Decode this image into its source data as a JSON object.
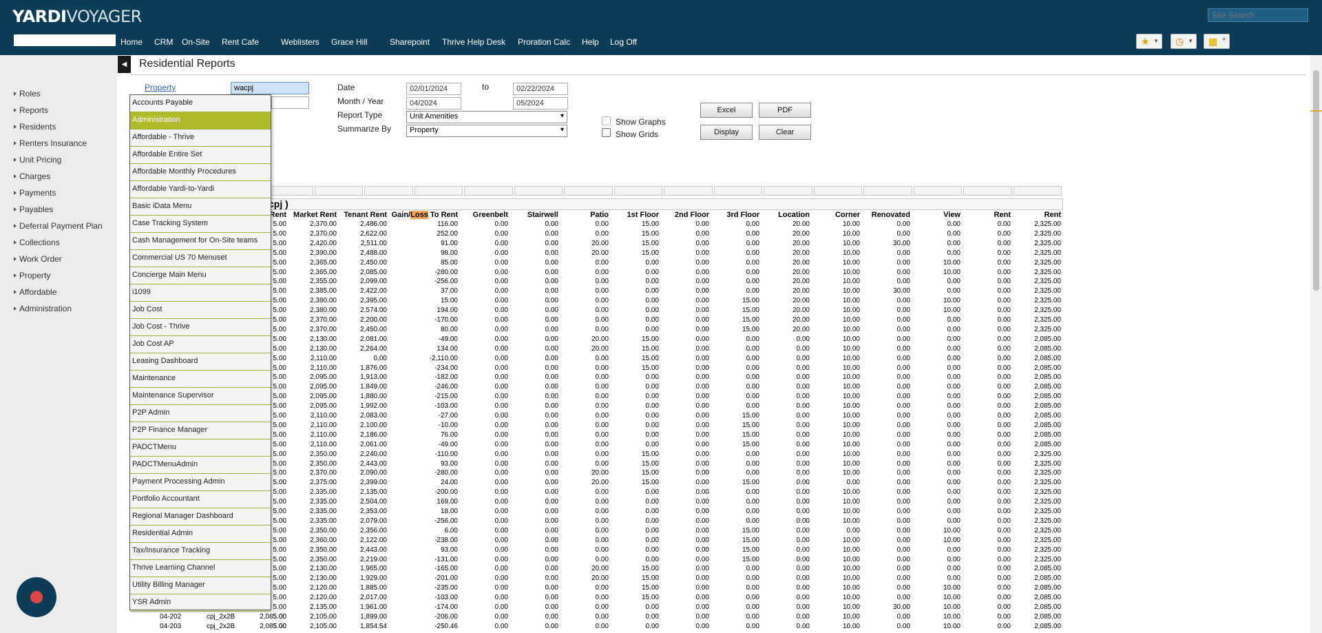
{
  "header": {
    "logo_bold": "YARDI",
    "logo_light": "VOYAGER",
    "site_search_placeholder": "Site Search",
    "search_value": "",
    "nav": [
      "Home",
      "CRM",
      "On-Site",
      "Rent Cafe",
      "Weblisters",
      "Grace Hill",
      "Sharepoint",
      "Thrive Help Desk",
      "Proration Calc",
      "Help",
      "Log Off"
    ]
  },
  "sidebar": {
    "items": [
      "Roles",
      "Reports",
      "Residents",
      "Renters Insurance",
      "Unit Pricing",
      "Charges",
      "Payments",
      "Payables",
      "Deferral Payment Plan",
      "Collections",
      "Work Order",
      "Property",
      "Affordable",
      "Administration"
    ]
  },
  "page": {
    "title": "Residential Reports"
  },
  "form": {
    "property_label": "Property",
    "property_value": "wacpj",
    "date_label": "Date",
    "date_from": "02/01/2024",
    "to_label": "to",
    "date_to": "02/22/2024",
    "month_year_label": "Month / Year",
    "month_from": "04/2024",
    "month_to": "05/2024",
    "report_type_label": "Report Type",
    "report_type_value": "Unit Amenities",
    "summarize_label": "Summarize By",
    "summarize_value": "Property",
    "show_graphs_label": "Show Graphs",
    "show_grids_label": "Show Grids",
    "buttons": {
      "excel": "Excel",
      "pdf": "PDF",
      "display": "Display",
      "clear": "Clear"
    }
  },
  "dropdown": {
    "items": [
      "Accounts Payable",
      "Administration",
      "Affordable - Thrive",
      "Affordable Entire Set",
      "Affordable Monthly Procedures",
      "Affordable Yardi-to-Yardi",
      "Basic iData Menu",
      "Case Tracking System",
      "Cash Management for On-Site teams",
      "Commercial US 70 Menuset",
      "Concierge Main Menu",
      "i1099",
      "Job Cost",
      "Job Cost - Thrive",
      "Job Cost AP",
      "Leasing Dashboard",
      "Maintenance",
      "Maintenance Supervisor",
      "P2P Admin",
      "P2P Finance Manager",
      "PADCTMenu",
      "PADCTMenuAdmin",
      "Payment Processing Admin",
      "Portfolio Accountant",
      "Regional Manager Dashboard",
      "Residential Admin",
      "Tax/Insurance Tracking",
      "Thrive Learning Channel",
      "Utility Billing Manager",
      "YSR Admin"
    ],
    "active_index": 1
  },
  "report": {
    "group_title": "cpj )",
    "columns": [
      "Rent",
      "Market Rent",
      "Tenant Rent",
      "Gain/Loss To Rent",
      "Greenbelt",
      "Stairwell",
      "Patio",
      "1st Floor",
      "2nd Floor",
      "3rd Floor",
      "Location",
      "Corner",
      "Renovated",
      "View",
      "Rent",
      "Rent"
    ],
    "highlight_col": 3,
    "highlight_part": "Loss",
    "rows": [
      [
        "5.00",
        "2,370.00",
        "2,486.00",
        "116.00",
        "0.00",
        "0.00",
        "0.00",
        "15.00",
        "0.00",
        "0.00",
        "20.00",
        "10.00",
        "0.00",
        "0.00",
        "0.00",
        "2,325.00"
      ],
      [
        "5.00",
        "2,370.00",
        "2,622.00",
        "252.00",
        "0.00",
        "0.00",
        "0.00",
        "15.00",
        "0.00",
        "0.00",
        "20.00",
        "10.00",
        "0.00",
        "0.00",
        "0.00",
        "2,325.00"
      ],
      [
        "5.00",
        "2,420.00",
        "2,511.00",
        "91.00",
        "0.00",
        "0.00",
        "20.00",
        "15.00",
        "0.00",
        "0.00",
        "20.00",
        "10.00",
        "30.00",
        "0.00",
        "0.00",
        "2,325.00"
      ],
      [
        "5.00",
        "2,390.00",
        "2,488.00",
        "98.00",
        "0.00",
        "0.00",
        "20.00",
        "15.00",
        "0.00",
        "0.00",
        "20.00",
        "10.00",
        "0.00",
        "0.00",
        "0.00",
        "2,325.00"
      ],
      [
        "5.00",
        "2,365.00",
        "2,450.00",
        "85.00",
        "0.00",
        "0.00",
        "0.00",
        "0.00",
        "0.00",
        "0.00",
        "20.00",
        "10.00",
        "0.00",
        "10.00",
        "0.00",
        "2,325.00"
      ],
      [
        "5.00",
        "2,365.00",
        "2,085.00",
        "-280.00",
        "0.00",
        "0.00",
        "0.00",
        "0.00",
        "0.00",
        "0.00",
        "20.00",
        "10.00",
        "0.00",
        "10.00",
        "0.00",
        "2,325.00"
      ],
      [
        "5.00",
        "2,355.00",
        "2,099.00",
        "-256.00",
        "0.00",
        "0.00",
        "0.00",
        "0.00",
        "0.00",
        "0.00",
        "20.00",
        "10.00",
        "0.00",
        "0.00",
        "0.00",
        "2,325.00"
      ],
      [
        "5.00",
        "2,385.00",
        "2,422.00",
        "37.00",
        "0.00",
        "0.00",
        "0.00",
        "0.00",
        "0.00",
        "0.00",
        "20.00",
        "10.00",
        "30.00",
        "0.00",
        "0.00",
        "2,325.00"
      ],
      [
        "5.00",
        "2,380.00",
        "2,395.00",
        "15.00",
        "0.00",
        "0.00",
        "0.00",
        "0.00",
        "0.00",
        "15.00",
        "20.00",
        "10.00",
        "0.00",
        "10.00",
        "0.00",
        "2,325.00"
      ],
      [
        "5.00",
        "2,380.00",
        "2,574.00",
        "194.00",
        "0.00",
        "0.00",
        "0.00",
        "0.00",
        "0.00",
        "15.00",
        "20.00",
        "10.00",
        "0.00",
        "10.00",
        "0.00",
        "2,325.00"
      ],
      [
        "5.00",
        "2,370.00",
        "2,200.00",
        "-170.00",
        "0.00",
        "0.00",
        "0.00",
        "0.00",
        "0.00",
        "15.00",
        "20.00",
        "10.00",
        "0.00",
        "0.00",
        "0.00",
        "2,325.00"
      ],
      [
        "5.00",
        "2,370.00",
        "2,450.00",
        "80.00",
        "0.00",
        "0.00",
        "0.00",
        "0.00",
        "0.00",
        "15.00",
        "20.00",
        "10.00",
        "0.00",
        "0.00",
        "0.00",
        "2,325.00"
      ],
      [
        "5.00",
        "2,130.00",
        "2,081.00",
        "-49.00",
        "0.00",
        "0.00",
        "20.00",
        "15.00",
        "0.00",
        "0.00",
        "0.00",
        "10.00",
        "0.00",
        "0.00",
        "0.00",
        "2,085.00"
      ],
      [
        "5.00",
        "2,130.00",
        "2,264.00",
        "134.00",
        "0.00",
        "0.00",
        "20.00",
        "15.00",
        "0.00",
        "0.00",
        "0.00",
        "10.00",
        "0.00",
        "0.00",
        "0.00",
        "2,085.00"
      ],
      [
        "5.00",
        "2,110.00",
        "0.00",
        "-2,110.00",
        "0.00",
        "0.00",
        "0.00",
        "15.00",
        "0.00",
        "0.00",
        "0.00",
        "10.00",
        "0.00",
        "0.00",
        "0.00",
        "2,085.00"
      ],
      [
        "5.00",
        "2,110.00",
        "1,876.00",
        "-234.00",
        "0.00",
        "0.00",
        "0.00",
        "15.00",
        "0.00",
        "0.00",
        "0.00",
        "10.00",
        "0.00",
        "0.00",
        "0.00",
        "2,085.00"
      ],
      [
        "5.00",
        "2,095.00",
        "1,913.00",
        "-182.00",
        "0.00",
        "0.00",
        "0.00",
        "0.00",
        "0.00",
        "0.00",
        "0.00",
        "10.00",
        "0.00",
        "0.00",
        "0.00",
        "2,085.00"
      ],
      [
        "5.00",
        "2,095.00",
        "1,849.00",
        "-246.00",
        "0.00",
        "0.00",
        "0.00",
        "0.00",
        "0.00",
        "0.00",
        "0.00",
        "10.00",
        "0.00",
        "0.00",
        "0.00",
        "2,085.00"
      ],
      [
        "5.00",
        "2,095.00",
        "1,880.00",
        "-215.00",
        "0.00",
        "0.00",
        "0.00",
        "0.00",
        "0.00",
        "0.00",
        "0.00",
        "10.00",
        "0.00",
        "0.00",
        "0.00",
        "2,085.00"
      ],
      [
        "5.00",
        "2,095.00",
        "1,992.00",
        "-103.00",
        "0.00",
        "0.00",
        "0.00",
        "0.00",
        "0.00",
        "0.00",
        "0.00",
        "10.00",
        "0.00",
        "0.00",
        "0.00",
        "2,085.00"
      ],
      [
        "5.00",
        "2,110.00",
        "2,083.00",
        "-27.00",
        "0.00",
        "0.00",
        "0.00",
        "0.00",
        "0.00",
        "15.00",
        "0.00",
        "10.00",
        "0.00",
        "0.00",
        "0.00",
        "2,085.00"
      ],
      [
        "5.00",
        "2,110.00",
        "2,100.00",
        "-10.00",
        "0.00",
        "0.00",
        "0.00",
        "0.00",
        "0.00",
        "15.00",
        "0.00",
        "10.00",
        "0.00",
        "0.00",
        "0.00",
        "2,085.00"
      ],
      [
        "5.00",
        "2,110.00",
        "2,186.00",
        "76.00",
        "0.00",
        "0.00",
        "0.00",
        "0.00",
        "0.00",
        "15.00",
        "0.00",
        "10.00",
        "0.00",
        "0.00",
        "0.00",
        "2,085.00"
      ],
      [
        "5.00",
        "2,110.00",
        "2,061.00",
        "-49.00",
        "0.00",
        "0.00",
        "0.00",
        "0.00",
        "0.00",
        "15.00",
        "0.00",
        "10.00",
        "0.00",
        "0.00",
        "0.00",
        "2,085.00"
      ],
      [
        "5.00",
        "2,350.00",
        "2,240.00",
        "-110.00",
        "0.00",
        "0.00",
        "0.00",
        "15.00",
        "0.00",
        "0.00",
        "0.00",
        "10.00",
        "0.00",
        "0.00",
        "0.00",
        "2,325.00"
      ],
      [
        "5.00",
        "2,350.00",
        "2,443.00",
        "93.00",
        "0.00",
        "0.00",
        "0.00",
        "15.00",
        "0.00",
        "0.00",
        "0.00",
        "10.00",
        "0.00",
        "0.00",
        "0.00",
        "2,325.00"
      ],
      [
        "5.00",
        "2,370.00",
        "2,090.00",
        "-280.00",
        "0.00",
        "0.00",
        "20.00",
        "15.00",
        "0.00",
        "0.00",
        "0.00",
        "10.00",
        "0.00",
        "0.00",
        "0.00",
        "2,325.00"
      ],
      [
        "5.00",
        "2,375.00",
        "2,399.00",
        "24.00",
        "0.00",
        "0.00",
        "20.00",
        "15.00",
        "0.00",
        "15.00",
        "0.00",
        "0.00",
        "0.00",
        "0.00",
        "0.00",
        "2,325.00"
      ],
      [
        "5.00",
        "2,335.00",
        "2,135.00",
        "-200.00",
        "0.00",
        "0.00",
        "0.00",
        "0.00",
        "0.00",
        "0.00",
        "0.00",
        "10.00",
        "0.00",
        "0.00",
        "0.00",
        "2,325.00"
      ],
      [
        "5.00",
        "2,335.00",
        "2,504.00",
        "169.00",
        "0.00",
        "0.00",
        "0.00",
        "0.00",
        "0.00",
        "0.00",
        "0.00",
        "10.00",
        "0.00",
        "0.00",
        "0.00",
        "2,325.00"
      ],
      [
        "5.00",
        "2,335.00",
        "2,353.00",
        "18.00",
        "0.00",
        "0.00",
        "0.00",
        "0.00",
        "0.00",
        "0.00",
        "0.00",
        "10.00",
        "0.00",
        "0.00",
        "0.00",
        "2,325.00"
      ],
      [
        "5.00",
        "2,335.00",
        "2,079.00",
        "-256.00",
        "0.00",
        "0.00",
        "0.00",
        "0.00",
        "0.00",
        "0.00",
        "0.00",
        "10.00",
        "0.00",
        "0.00",
        "0.00",
        "2,325.00"
      ],
      [
        "5.00",
        "2,350.00",
        "2,356.00",
        "6.00",
        "0.00",
        "0.00",
        "0.00",
        "0.00",
        "0.00",
        "15.00",
        "0.00",
        "0.00",
        "0.00",
        "10.00",
        "0.00",
        "2,325.00"
      ],
      [
        "5.00",
        "2,360.00",
        "2,122.00",
        "-238.00",
        "0.00",
        "0.00",
        "0.00",
        "0.00",
        "0.00",
        "15.00",
        "0.00",
        "10.00",
        "0.00",
        "10.00",
        "0.00",
        "2,325.00"
      ],
      [
        "5.00",
        "2,350.00",
        "2,443.00",
        "93.00",
        "0.00",
        "0.00",
        "0.00",
        "0.00",
        "0.00",
        "15.00",
        "0.00",
        "10.00",
        "0.00",
        "0.00",
        "0.00",
        "2,325.00"
      ],
      [
        "5.00",
        "2,350.00",
        "2,219.00",
        "-131.00",
        "0.00",
        "0.00",
        "0.00",
        "0.00",
        "0.00",
        "15.00",
        "0.00",
        "10.00",
        "0.00",
        "0.00",
        "0.00",
        "2,325.00"
      ],
      [
        "5.00",
        "2,130.00",
        "1,965.00",
        "-165.00",
        "0.00",
        "0.00",
        "20.00",
        "15.00",
        "0.00",
        "0.00",
        "0.00",
        "10.00",
        "0.00",
        "0.00",
        "0.00",
        "2,085.00"
      ],
      [
        "5.00",
        "2,130.00",
        "1,929.00",
        "-201.00",
        "0.00",
        "0.00",
        "20.00",
        "15.00",
        "0.00",
        "0.00",
        "0.00",
        "10.00",
        "0.00",
        "0.00",
        "0.00",
        "2,085.00"
      ],
      [
        "5.00",
        "2,120.00",
        "1,885.00",
        "-235.00",
        "0.00",
        "0.00",
        "0.00",
        "15.00",
        "0.00",
        "0.00",
        "0.00",
        "10.00",
        "0.00",
        "10.00",
        "0.00",
        "2,085.00"
      ],
      [
        "5.00",
        "2,120.00",
        "2,017.00",
        "-103.00",
        "0.00",
        "0.00",
        "0.00",
        "15.00",
        "0.00",
        "0.00",
        "0.00",
        "10.00",
        "0.00",
        "10.00",
        "0.00",
        "2,085.00"
      ],
      [
        "5.00",
        "2,135.00",
        "1,961.00",
        "-174.00",
        "0.00",
        "0.00",
        "0.00",
        "0.00",
        "0.00",
        "0.00",
        "0.00",
        "10.00",
        "30.00",
        "10.00",
        "0.00",
        "2,085.00"
      ],
      [
        "5.00",
        "2,105.00",
        "1,899.00",
        "-206.00",
        "0.00",
        "0.00",
        "0.00",
        "0.00",
        "0.00",
        "0.00",
        "0.00",
        "10.00",
        "0.00",
        "10.00",
        "0.00",
        "2,085.00"
      ],
      [
        "5.00",
        "2,105.00",
        "1,854.54",
        "-250.46",
        "0.00",
        "0.00",
        "0.00",
        "0.00",
        "0.00",
        "0.00",
        "0.00",
        "10.00",
        "0.00",
        "10.00",
        "0.00",
        "2,085.00"
      ]
    ],
    "bottom_rows": [
      {
        "unit": "04-202",
        "type": "cpj_2x2B",
        "rent": "2,085.00"
      },
      {
        "unit": "04-203",
        "type": "cpj_2x2B",
        "rent": "2,085.00"
      }
    ]
  },
  "colors": {
    "header_bg": "#0d3c56",
    "dropdown_active": "#b1ba2a",
    "highlight": "#f3a553"
  },
  "icons": [
    "star-icon",
    "history-icon",
    "apps-icon",
    "chat-icon"
  ]
}
